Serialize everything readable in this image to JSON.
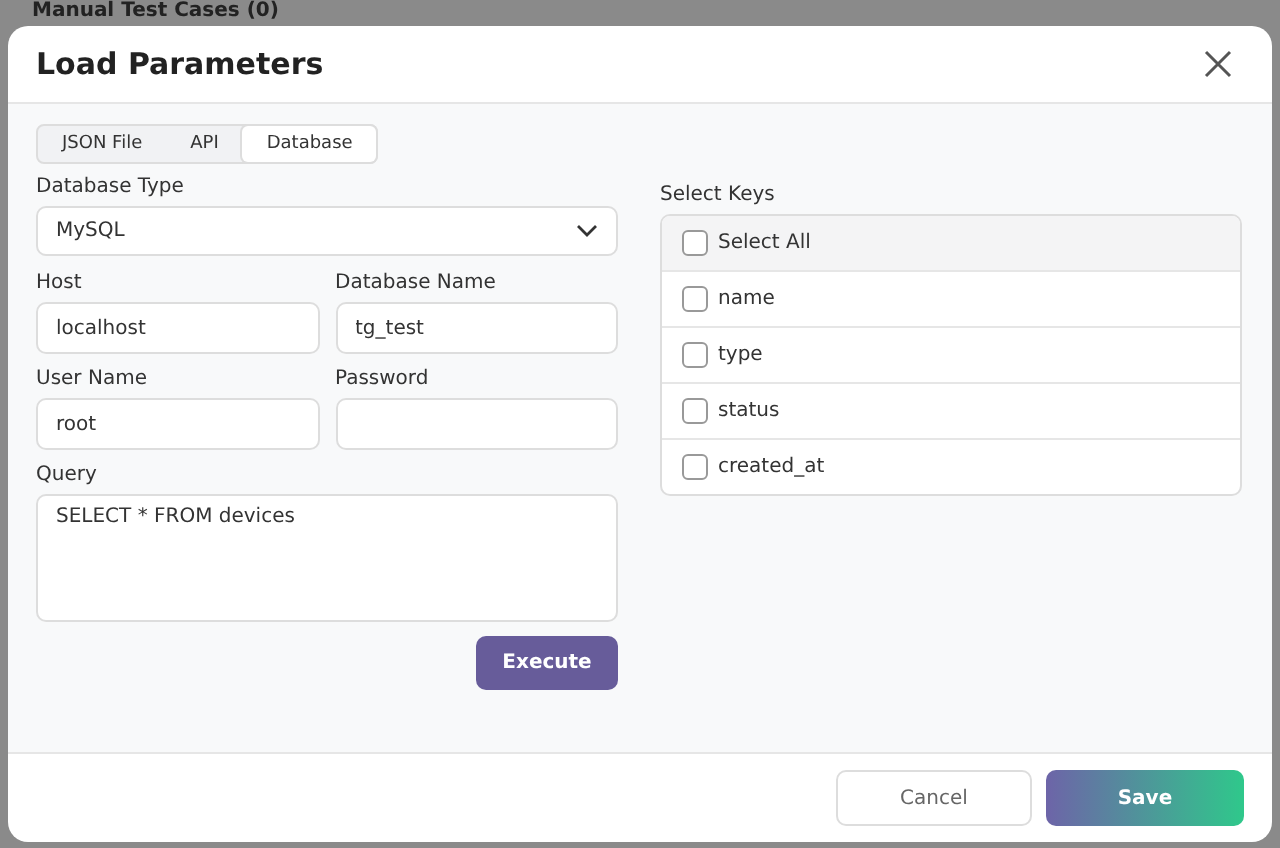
{
  "backdrop": {
    "title": "Manual Test Cases (0)"
  },
  "dialog": {
    "title": "Load Parameters"
  },
  "tabs": [
    {
      "label": "JSON File",
      "selected": false
    },
    {
      "label": "API",
      "selected": false
    },
    {
      "label": "Database",
      "selected": true
    }
  ],
  "database_type": {
    "label": "Database Type",
    "value": "MySQL"
  },
  "fields": [
    {
      "label": "Host",
      "value": "localhost"
    },
    {
      "label": "Database Name",
      "value": "tg_test"
    },
    {
      "label": "User Name",
      "value": "root"
    },
    {
      "label": "Password"
    }
  ],
  "query": {
    "label": "Query",
    "value": "SELECT * FROM devices"
  },
  "execute_button": "Execute",
  "select_keys": {
    "label": "Select Keys",
    "items": [
      {
        "label": "Select All",
        "checked": false,
        "kind": "all"
      },
      {
        "label": "name",
        "checked": false,
        "kind": "key"
      },
      {
        "label": "type",
        "checked": false,
        "kind": "key"
      },
      {
        "label": "status",
        "checked": false,
        "kind": "key"
      },
      {
        "label": "created_at",
        "checked": false,
        "kind": "key"
      }
    ]
  },
  "footer": {
    "cancel": "Cancel",
    "save": "Save"
  }
}
